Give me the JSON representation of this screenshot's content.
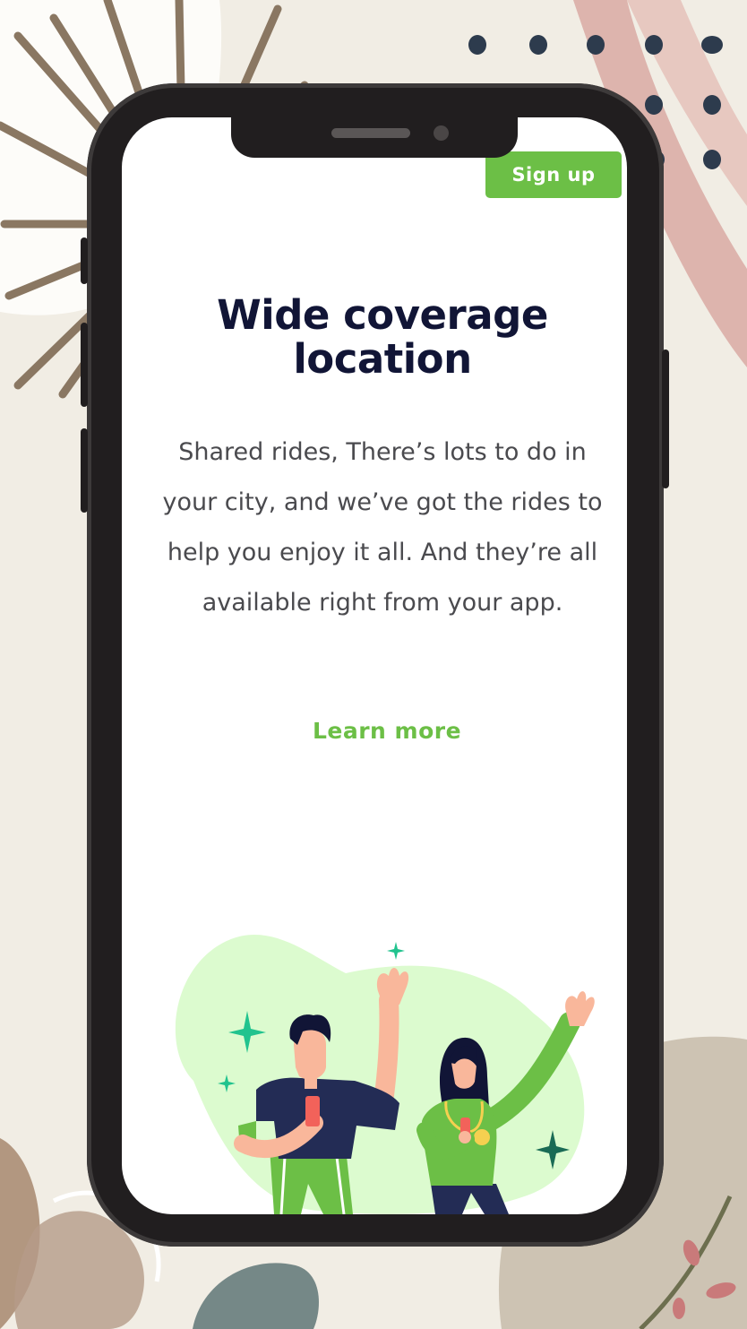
{
  "colors": {
    "background": "#f1ede4",
    "phone_frame": "#211e1f",
    "screen": "#ffffff",
    "accent": "#6cbf46",
    "heading": "#111536",
    "body_text": "#4a4a4e"
  },
  "header": {
    "signup_label": "Sign up"
  },
  "main": {
    "title": "Wide coverage location",
    "description": "Shared rides, There’s lots to do in your city, and we’ve got the rides to help you enjoy it all. And they’re all available right from your app.",
    "learn_more": "Learn more"
  },
  "illustration": {
    "subject": "two-people-waving-illustration",
    "icons": [
      "sparkle-icon"
    ]
  }
}
